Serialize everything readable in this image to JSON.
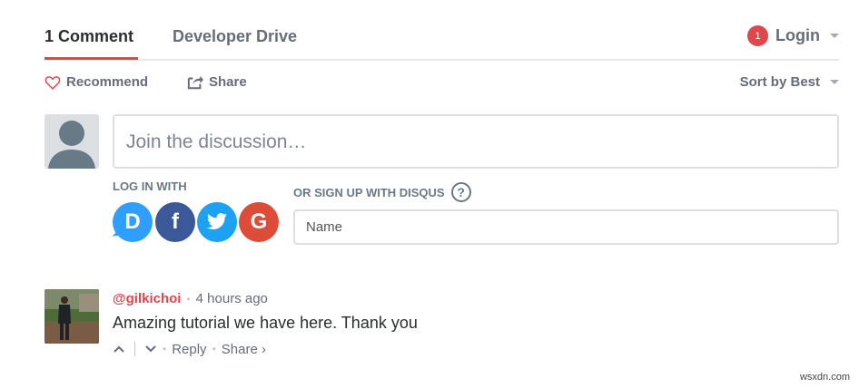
{
  "nav": {
    "comments_tab": "1 Comment",
    "forum_tab": "Developer Drive",
    "notification_count": "1",
    "login_label": "Login"
  },
  "actions": {
    "recommend_label": "Recommend",
    "share_label": "Share",
    "sort_label": "Sort by Best"
  },
  "composer": {
    "placeholder": "Join the discussion…",
    "login_with_label": "LOG IN WITH",
    "social": [
      "D",
      "f",
      "G"
    ],
    "signup_label": "OR SIGN UP WITH DISQUS",
    "help_label": "?",
    "name_placeholder": "Name"
  },
  "comment": {
    "author": "@gilkichoi",
    "separator": "•",
    "time": "4 hours ago",
    "body": "Amazing tutorial we have here. Thank you",
    "reply_label": "Reply",
    "share_label": "Share ›"
  },
  "watermark": "wsxdn.com",
  "colors": {
    "accent": "#e0474c",
    "muted_text": "#656c7a",
    "border": "#dbdfe4",
    "disqus": "#2e9fff",
    "facebook": "#3b5998",
    "twitter": "#1da1f2",
    "google": "#dd4b39"
  }
}
